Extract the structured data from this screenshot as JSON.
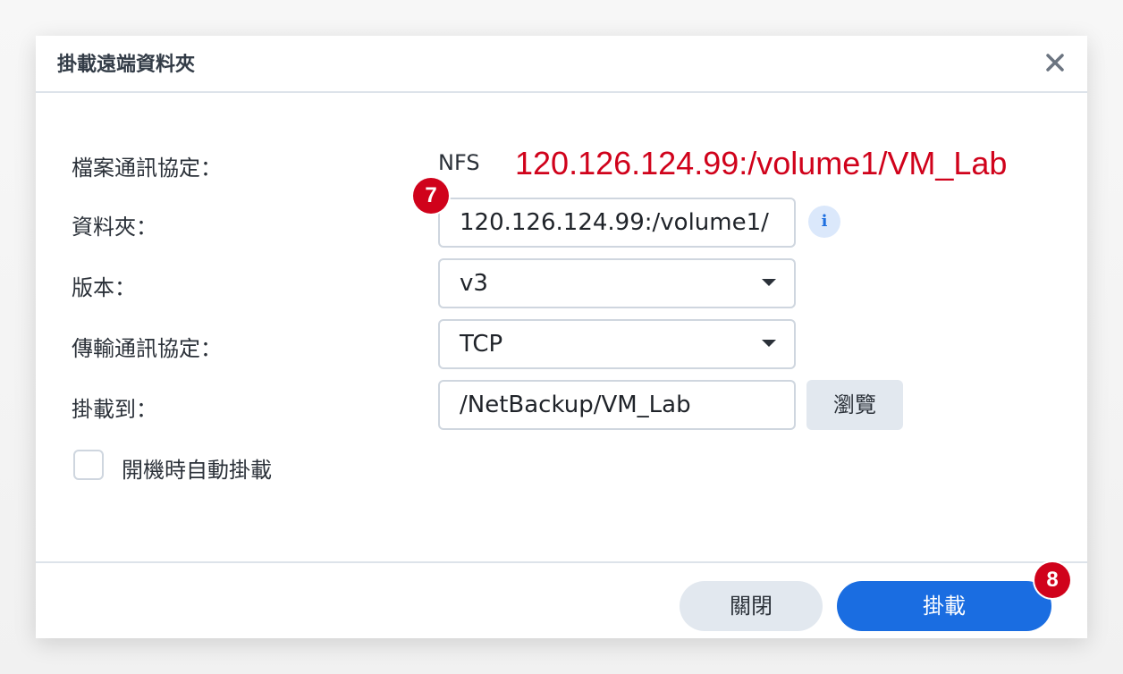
{
  "dialog": {
    "title": "掛載遠端資料夾",
    "close_icon": "close-icon"
  },
  "form": {
    "protocol_label": "檔案通訊協定：",
    "protocol_value": "NFS",
    "folder_label": "資料夾：",
    "folder_value": "120.126.124.99:/volume1/",
    "version_label": "版本：",
    "version_value": "v3",
    "transport_label": "傳輸通訊協定：",
    "transport_value": "TCP",
    "mount_to_label": "掛載到：",
    "mount_to_value": "/NetBackup/VM_Lab",
    "browse_label": "瀏覽",
    "auto_mount_label": "開機時自動掛載",
    "info_icon": "info-icon",
    "info_glyph": "i"
  },
  "annotations": {
    "path_text": "120.126.124.99:/volume1/VM_Lab",
    "badge_7": "7",
    "badge_8": "8",
    "color": "#d0021b"
  },
  "footer": {
    "close_label": "關閉",
    "mount_label": "掛載"
  },
  "colors": {
    "primary": "#1a6de1",
    "secondary_button": "#e2e8ef",
    "border": "#cfd6df"
  }
}
